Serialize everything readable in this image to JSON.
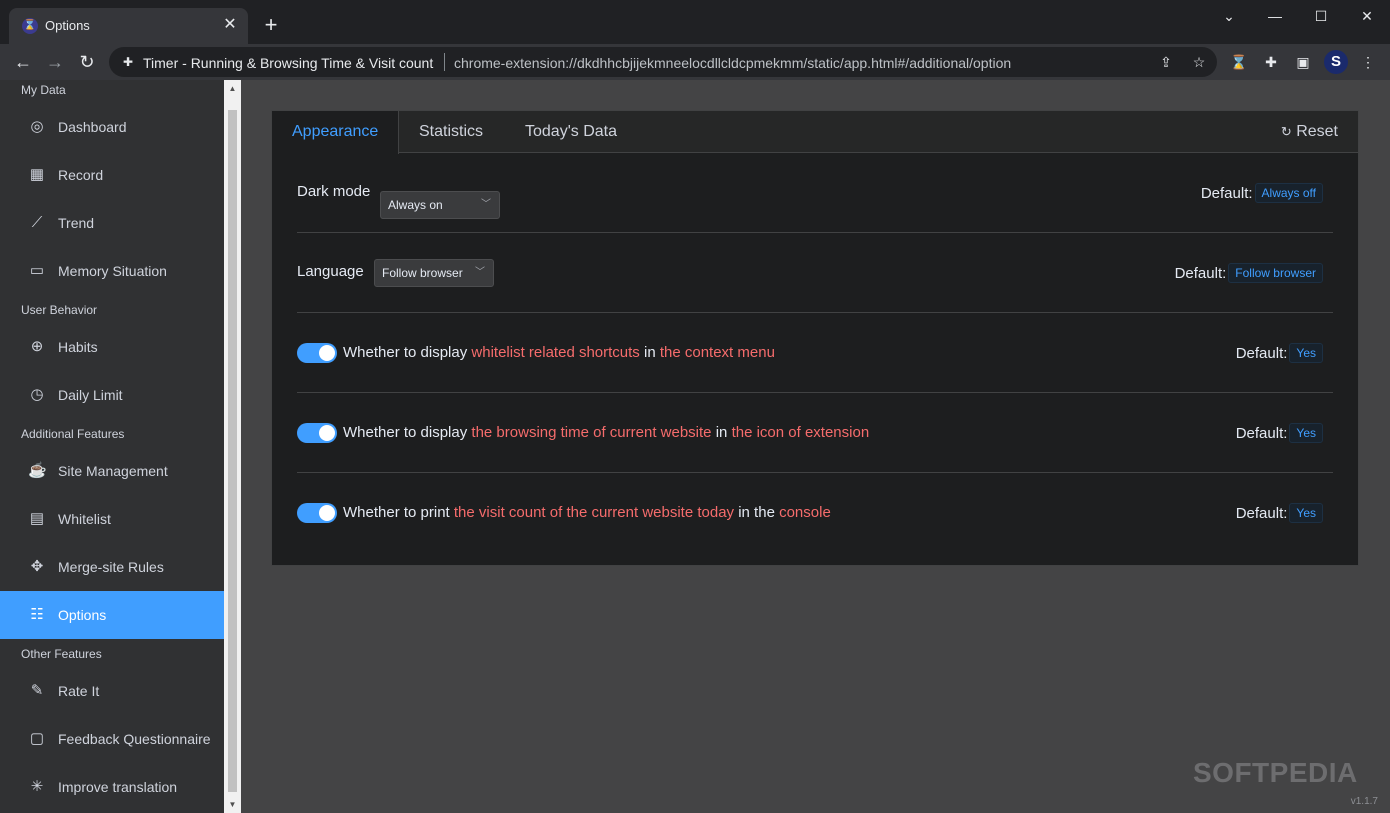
{
  "browser": {
    "tab_title": "Options",
    "tab_favicon": "⌛",
    "address_title": "Timer - Running & Browsing Time & Visit count",
    "address_url": "chrome-extension://dkdhhcbjijekmneelocdllcldcpmekmm/static/app.html#/additional/option",
    "profile_initial": "S"
  },
  "sidebar": {
    "groups": {
      "my_data": "My Data",
      "user_behavior": "User Behavior",
      "additional": "Additional Features",
      "other": "Other Features"
    },
    "items": {
      "dashboard": "Dashboard",
      "record": "Record",
      "trend": "Trend",
      "memory": "Memory Situation",
      "habits": "Habits",
      "daily_limit": "Daily Limit",
      "site_management": "Site Management",
      "whitelist": "Whitelist",
      "merge_rules": "Merge-site Rules",
      "options": "Options",
      "rate_it": "Rate It",
      "feedback": "Feedback Questionnaire",
      "improve_translation": "Improve translation"
    },
    "active": "options"
  },
  "tabs": {
    "appearance": "Appearance",
    "statistics": "Statistics",
    "today": "Today's Data",
    "reset": "Reset"
  },
  "settings": {
    "default_label": "Default:",
    "dark_mode": {
      "label": "Dark mode",
      "value": "Always on",
      "default": "Always off"
    },
    "language": {
      "label": "Language",
      "value": "Follow browser",
      "default": "Follow browser"
    },
    "shortcuts": {
      "enabled": true,
      "p1": "Whether to display",
      "h1": "whitelist related shortcuts",
      "p2": "in",
      "h2": "the context menu",
      "default": "Yes"
    },
    "badge": {
      "enabled": true,
      "p1": "Whether to display",
      "h1": "the browsing time of current website",
      "p2": "in",
      "h2": "the icon of extension",
      "default": "Yes"
    },
    "console": {
      "enabled": true,
      "p1": "Whether to print",
      "h1": "the visit count of the current website today",
      "p2": "in the",
      "h2": "console",
      "default": "Yes"
    }
  },
  "watermark": "SOFTPEDIA",
  "version": "v1.1.7",
  "colors": {
    "accent": "#409eff",
    "highlight": "#f56c6c"
  }
}
